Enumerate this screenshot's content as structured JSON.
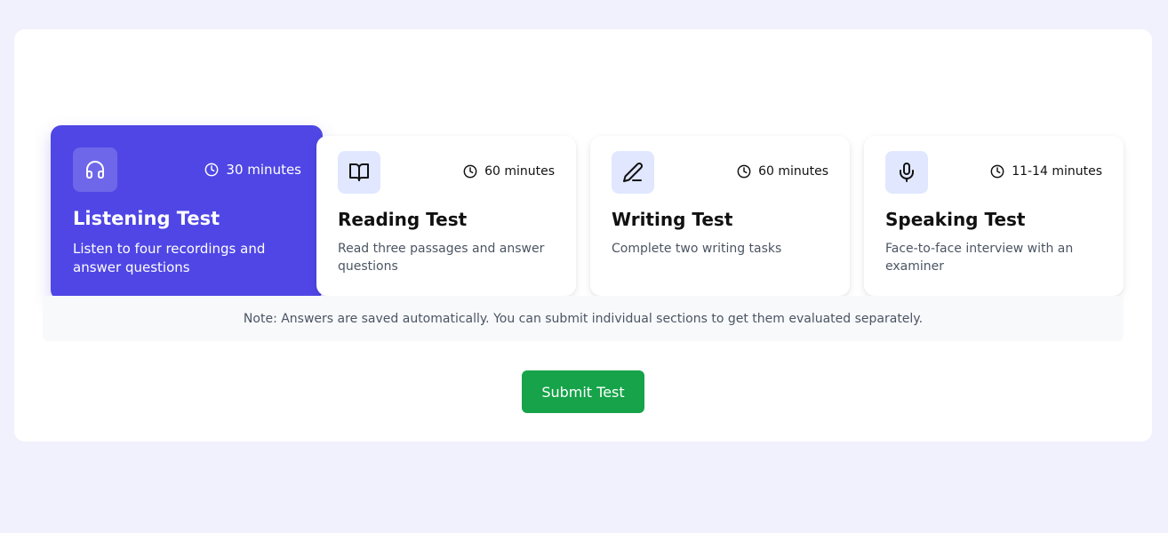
{
  "cards": [
    {
      "title": "Listening Test",
      "description": "Listen to four recordings and answer questions",
      "duration": "30 minutes",
      "icon": "headphones-icon",
      "active": true
    },
    {
      "title": "Reading Test",
      "description": "Read three passages and answer questions",
      "duration": "60 minutes",
      "icon": "book-icon",
      "active": false
    },
    {
      "title": "Writing Test",
      "description": "Complete two writing tasks",
      "duration": "60 minutes",
      "icon": "pen-icon",
      "active": false
    },
    {
      "title": "Speaking Test",
      "description": "Face-to-face interview with an examiner",
      "duration": "11-14 minutes",
      "icon": "microphone-icon",
      "active": false
    }
  ],
  "note": "Note: Answers are saved automatically. You can submit individual sections to get them evaluated separately.",
  "submit_label": "Submit Test",
  "colors": {
    "active_card": "#4f46e5",
    "icon_bg": "#e0e7ff",
    "submit": "#16a34a",
    "page_bg": "#f1f1fd"
  }
}
